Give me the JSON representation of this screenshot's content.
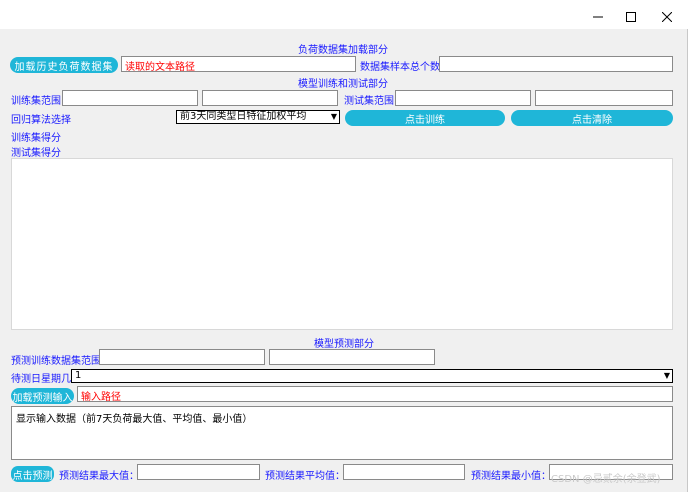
{
  "window": {
    "minimize_symbol": "—",
    "maximize_symbol": "☐",
    "close_symbol": "✕"
  },
  "load_section": {
    "title": "负荷数据集加载部分",
    "load_button": "加载历史负荷数据集",
    "path_value": "读取的文本路径",
    "sample_count_label": "数据集样本总个数",
    "sample_count_value": ""
  },
  "train_section": {
    "title": "模型训练和测试部分",
    "train_range_label": "训练集范围",
    "train_range_from": "",
    "train_range_to": "",
    "test_range_label": "测试集范围",
    "test_range_from": "",
    "test_range_to": "",
    "algo_label": "回归算法选择",
    "algo_selected": "前3天同类型日特征加权平均",
    "train_button": "点击训练",
    "clear_button": "点击清除",
    "train_score_label": "训练集得分",
    "test_score_label": "测试集得分"
  },
  "predict_section": {
    "title": "模型预测部分",
    "pred_train_range_label": "预测训练数据集范围",
    "pred_train_range_from": "",
    "pred_train_range_to": "",
    "weekday_label": "待测日星期几",
    "weekday_selected": "1",
    "load_pred_button": "加载预测输入",
    "pred_path_value": "输入路径",
    "display_text": "显示输入数据（前7天负荷最大值、平均值、最小值）",
    "predict_button": "点击预测",
    "max_label": "预测结果最大值：",
    "max_value": "",
    "avg_label": "预测结果平均值：",
    "avg_value": "",
    "min_label": "预测结果最小值：",
    "min_value": ""
  },
  "watermark": "CSDN @忌贰余(余登武)"
}
